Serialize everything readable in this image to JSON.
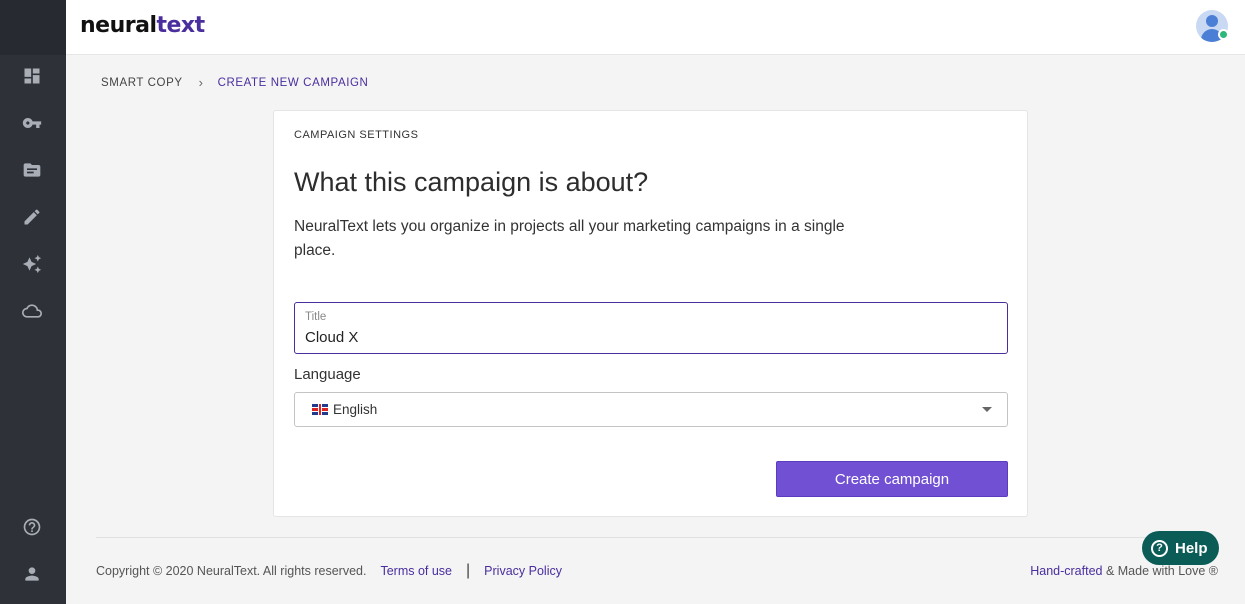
{
  "app": {
    "logo_main": "neural",
    "logo_accent": "text"
  },
  "sidebar": {
    "items": [
      {
        "icon": "dashboard-icon"
      },
      {
        "icon": "key-icon"
      },
      {
        "icon": "folder-icon"
      },
      {
        "icon": "pencil-icon"
      },
      {
        "icon": "sparkle-icon"
      },
      {
        "icon": "cloud-icon"
      },
      {
        "icon": "help-circle-icon"
      },
      {
        "icon": "user-icon"
      }
    ]
  },
  "breadcrumb": {
    "parent": "SMART COPY",
    "separator": "›",
    "current": "CREATE NEW CAMPAIGN"
  },
  "card": {
    "section_label": "CAMPAIGN SETTINGS",
    "title": "What this campaign is about?",
    "description": "NeuralText lets you organize in projects all your marketing campaigns in a single place.",
    "title_field": {
      "label": "Title",
      "value": "Cloud X"
    },
    "language": {
      "label": "Language",
      "selected": "English",
      "flag": "🇬🇧"
    },
    "submit_label": "Create campaign"
  },
  "footer": {
    "copyright": "Copyright © 2020 NeuralText. All rights reserved.",
    "terms": "Terms of use",
    "divider": "|",
    "privacy": "Privacy Policy",
    "handcrafted": "Hand-crafted",
    "made_with": " & Made with Love ®"
  },
  "help": {
    "label": "Help",
    "icon_glyph": "?"
  },
  "colors": {
    "brand": "#4a2e9e",
    "button": "#7150d3",
    "sidebar": "#2e3138",
    "help": "#0b5c56",
    "status": "#2fb67c"
  }
}
